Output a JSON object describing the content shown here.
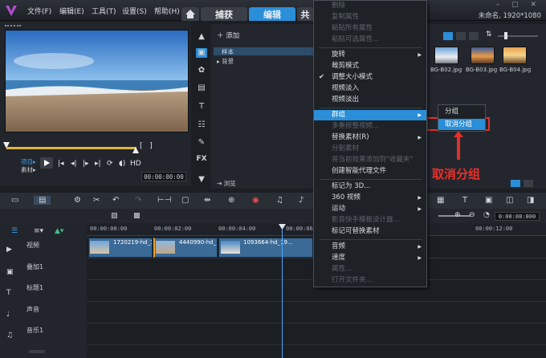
{
  "menu": [
    "文件(F)",
    "编辑(E)",
    "工具(T)",
    "设置(S)",
    "帮助(H)"
  ],
  "tabs": {
    "capture": "捕获",
    "edit": "编辑",
    "share": "共"
  },
  "project": {
    "label": "未命名, 1920*1080"
  },
  "preview": {
    "mode_project": "项目▸",
    "mode_clip": "素材▸",
    "hd": "HD",
    "timecode": "00:00:00:00"
  },
  "library": {
    "add": "添加",
    "folders": [
      "样本",
      "▸ 背景"
    ],
    "browse": "浏览",
    "thumbs": [
      "BG-B02.jpg",
      "BG-B03.jpg",
      "BG-B04.jpg"
    ]
  },
  "context_menu": [
    {
      "label": "删除",
      "disabled": true
    },
    {
      "label": "复制属性",
      "disabled": true
    },
    {
      "label": "粘贴所有属性",
      "disabled": true
    },
    {
      "label": "粘贴可选属性...",
      "disabled": true
    },
    {
      "sep": true
    },
    {
      "label": "旋转",
      "submenu": true
    },
    {
      "label": "裁剪模式"
    },
    {
      "label": "调整大小模式",
      "checked": true
    },
    {
      "label": "视频淡入"
    },
    {
      "label": "视频淡出"
    },
    {
      "sep": true
    },
    {
      "label": "群组",
      "submenu": true,
      "active": true
    },
    {
      "label": "多重修整视频...",
      "disabled": true
    },
    {
      "label": "替换素材(R)",
      "submenu": true
    },
    {
      "label": "分割素材",
      "disabled": true
    },
    {
      "label": "将当前效果添加到\"收藏夹\"",
      "disabled": true
    },
    {
      "label": "创建智能代理文件"
    },
    {
      "sep": true
    },
    {
      "label": "标记为 3D..."
    },
    {
      "label": "360 视频",
      "submenu": true
    },
    {
      "label": "运动",
      "submenu": true
    },
    {
      "label": "影音快手模板设计器...",
      "disabled": true
    },
    {
      "label": "标记可替换素材"
    },
    {
      "sep": true
    },
    {
      "label": "音频",
      "submenu": true
    },
    {
      "label": "速度",
      "submenu": true
    },
    {
      "label": "属性...",
      "disabled": true
    },
    {
      "label": "打开文件夹...",
      "disabled": true
    }
  ],
  "submenu": [
    "分组",
    "取消分组"
  ],
  "annotation": {
    "text": "取消分组",
    "color": "#e0302a"
  },
  "timeline": {
    "time": "0:00:08:000",
    "ruler": [
      "00:00:00:00",
      "00:00:02:00",
      "00:00:04:00",
      "00:00:06:00",
      "00:00:12:00"
    ],
    "tracks": [
      "视频",
      "叠加1",
      "标题1",
      "声音",
      "音乐1"
    ],
    "clips": [
      "1720219-hd_19...",
      "4440990-hd_19...",
      "1093664-hd_19..."
    ]
  },
  "colors": {
    "accent": "#2a8fd8",
    "clip": "#3b6a96",
    "scrubber": "#e0b640"
  }
}
